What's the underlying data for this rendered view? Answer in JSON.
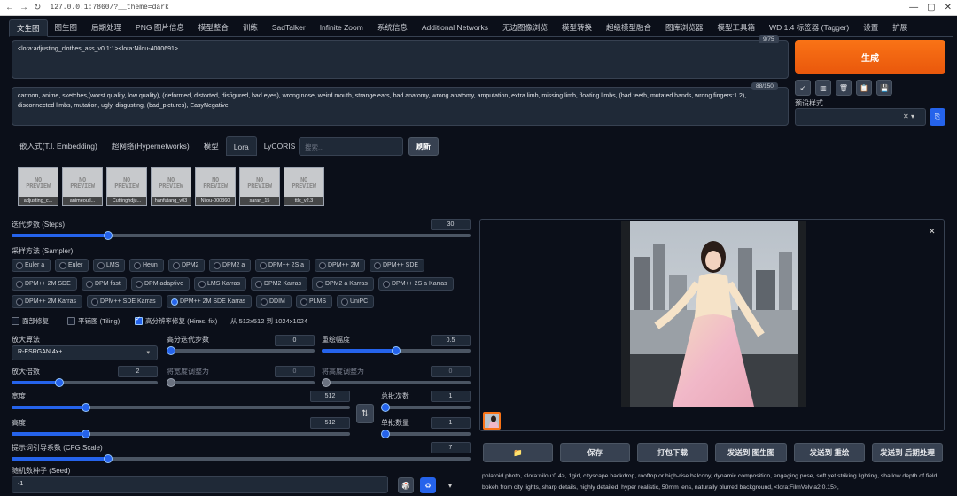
{
  "browser": {
    "url": "127.0.0.1:7860/?__theme=dark",
    "back": "←",
    "forward": "→",
    "reload": "↻",
    "window_controls": [
      "—",
      "▢",
      "✕"
    ]
  },
  "tabs": [
    "文生图",
    "图生图",
    "后期处理",
    "PNG 图片信息",
    "模型整合",
    "训练",
    "SadTalker",
    "Infinite Zoom",
    "系统信息",
    "Additional Networks",
    "无边图像浏览",
    "模型转换",
    "超级模型融合",
    "图库浏览器",
    "模型工具箱",
    "WD 1.4 标签器 (Tagger)",
    "设置",
    "扩展"
  ],
  "prompt": {
    "positive": "<lora:adjusting_clothes_ass_v0.1:1><lora:Nilou-4000691>",
    "positive_count": "9/75",
    "negative": "cartoon, anime, sketches,(worst quality, low quality), (deformed, distorted, disfigured, bad eyes), wrong nose, weird mouth, strange ears, bad anatomy, wrong anatomy, amputation, extra limb, missing limb, floating limbs, (bad teeth, mutated hands, wrong fingers:1.2), disconnected limbs, mutation, ugly, disgusting, (bad_pictures), EasyNegative",
    "negative_count": "88/150"
  },
  "generate": {
    "label": "生成",
    "tools": [
      "↙",
      "▥",
      "🗑",
      "📋",
      "💾"
    ],
    "style_label": "预设样式",
    "style_clear": "✕ ▾",
    "style_apply": "⎘"
  },
  "networks": {
    "tabs": [
      "嵌入式(T.I. Embedding)",
      "超网络(Hypernetworks)",
      "模型",
      "Lora",
      "LyCORIS"
    ],
    "active_tab": 3,
    "search_placeholder": "搜索...",
    "refresh": "刷新",
    "placeholder_text": "NO\nPREVIEW",
    "cards": [
      "adjusting_c...",
      "animeoutl...",
      "Cuttinghdju...",
      "hanfutang_v03",
      "Nilou-000360",
      "saran_15",
      "ttlc_v2.3"
    ]
  },
  "sampling": {
    "steps_label": "迭代步数 (Steps)",
    "steps": "30",
    "steps_frac": 0.21,
    "sampler_label": "采样方法 (Sampler)",
    "samplers": [
      [
        "Euler a",
        "Euler",
        "LMS",
        "Heun",
        "DPM2",
        "DPM2 a",
        "DPM++ 2S a",
        "DPM++ 2M",
        "DPM++ SDE"
      ],
      [
        "DPM++ 2M SDE",
        "DPM fast",
        "DPM adaptive",
        "LMS Karras",
        "DPM2 Karras",
        "DPM2 a Karras",
        "DPM++ 2S a Karras"
      ],
      [
        "DPM++ 2M Karras",
        "DPM++ SDE Karras",
        "DPM++ 2M SDE Karras",
        "DDIM",
        "PLMS",
        "UniPC"
      ]
    ],
    "selected_sampler": "DPM++ 2M SDE Karras"
  },
  "options": {
    "restore_faces": "面部修复",
    "tiling": "平铺图 (Tiling)",
    "hires_fix": "高分辨率修复 (Hires. fix)",
    "hires_note": "从 512x512 到 1024x1024"
  },
  "hires": {
    "upscaler_label": "放大算法",
    "upscaler": "R-ESRGAN 4x+",
    "hires_steps_label": "高分迭代步数",
    "hires_steps": "0",
    "hires_steps_frac": 0.0,
    "denoise_label": "重绘幅度",
    "denoise": "0.5",
    "denoise_frac": 0.5,
    "scale_label": "放大倍数",
    "scale": "2",
    "scale_frac": 0.33,
    "resize_w_label": "将宽度调整为",
    "resize_w": "0",
    "resize_w_frac": 0.0,
    "resize_h_label": "将高度调整为",
    "resize_h": "0",
    "resize_h_frac": 0.0
  },
  "dims": {
    "width_label": "宽度",
    "width": "512",
    "width_frac": 0.22,
    "height_label": "高度",
    "height": "512",
    "height_frac": 0.22,
    "swap": "⇅",
    "batch_count_label": "总批次数",
    "batch_count": "1",
    "batch_count_frac": 0.0,
    "batch_size_label": "单批数量",
    "batch_size": "1",
    "batch_size_frac": 0.0,
    "cfg_label": "提示词引导系数 (CFG Scale)",
    "cfg": "7",
    "cfg_frac": 0.21,
    "seed_label": "随机数种子 (Seed)",
    "seed": "-1",
    "seed_buttons": [
      "🎲",
      "♻",
      "▾"
    ]
  },
  "output": {
    "close": "✕",
    "actions": [
      "📁",
      "保存",
      "打包下载",
      "发送到 图生图",
      "发送到 重绘",
      "发送到 后期处理"
    ],
    "info": "polaroid photo, <lora:nilou:0.4>, 1girl, cityscape backdrop, rooftop or high-rise balcony, dynamic composition, engaging pose, soft yet striking lighting, shallow depth of field, bokeh from city lights, sharp details, highly detailed, hyper realistic, 50mm lens, naturally blurred background, <lora:FilmVelvia2:0.15>,"
  },
  "colors": {
    "accent": "#f97316",
    "blue": "#2563eb",
    "bg": "#0b0f19",
    "panel": "#1f2937"
  }
}
